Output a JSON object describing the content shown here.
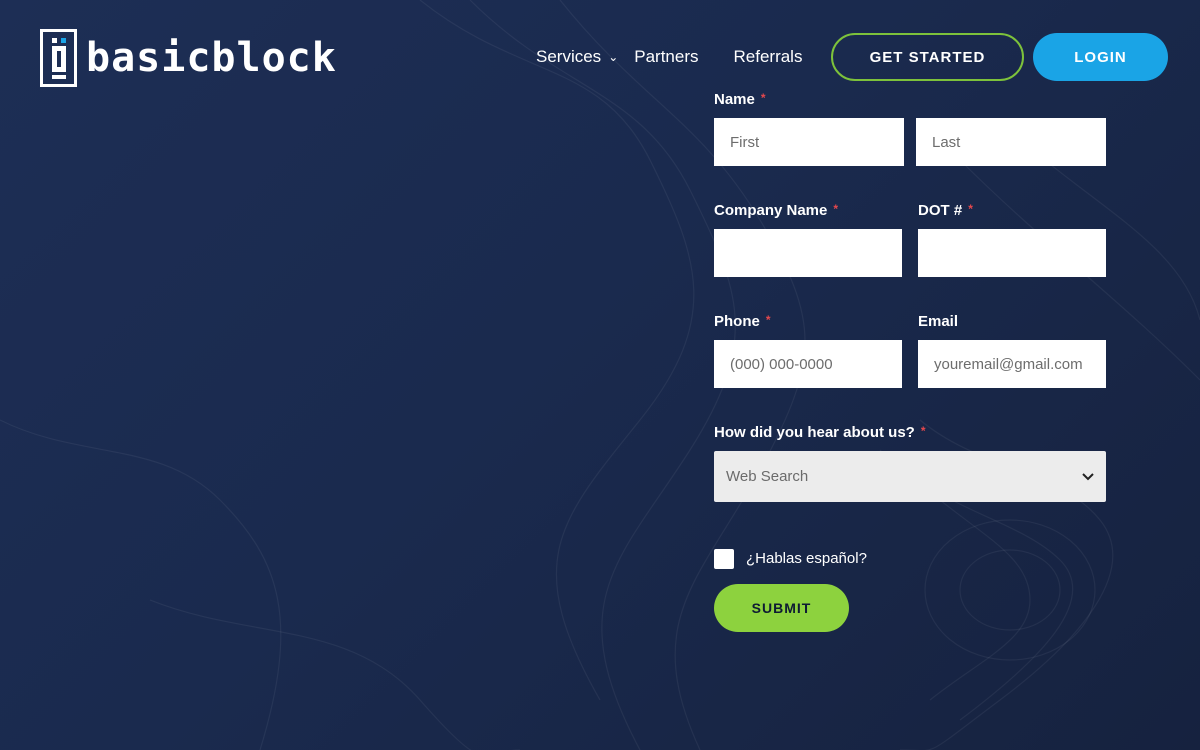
{
  "brand": {
    "name": "basicblock",
    "logo_icon": "logo-block-icon"
  },
  "nav": {
    "items": [
      {
        "label": "Services",
        "has_dropdown": true
      },
      {
        "label": "Partners"
      },
      {
        "label": "Referrals"
      }
    ],
    "get_started_label": "GET STARTED",
    "login_label": "LOGIN"
  },
  "form": {
    "name_label": "Name",
    "first_placeholder": "First",
    "last_placeholder": "Last",
    "company_label": "Company Name",
    "dot_label": "DOT #",
    "phone_label": "Phone",
    "phone_placeholder": "(000) 000-0000",
    "email_label": "Email",
    "email_placeholder": "youremail@gmail.com",
    "hear_label": "How did you hear about us?",
    "hear_value": "Web Search",
    "spanish_label": "¿Hablas español?",
    "submit_label": "SUBMIT",
    "required_mark": "*"
  },
  "colors": {
    "background": "#1a2a4e",
    "accent_green": "#8dd23e",
    "accent_blue": "#1aa4e6",
    "required_red": "#e5484d"
  }
}
